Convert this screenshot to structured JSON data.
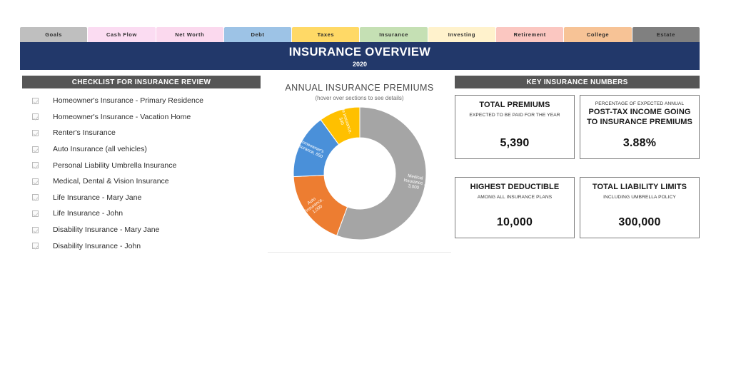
{
  "tabs": [
    {
      "label": "Goals",
      "color": "#bfbfbf",
      "text_color": "#2b2b2b",
      "active": true
    },
    {
      "label": "Cash Flow",
      "color": "#fbdcf2",
      "text_color": "#2b2b2b",
      "active": false
    },
    {
      "label": "Net Worth",
      "color": "#fbd9ee",
      "text_color": "#2b2b2b",
      "active": false
    },
    {
      "label": "Debt",
      "color": "#9dc3e6",
      "text_color": "#2b2b2b",
      "active": false
    },
    {
      "label": "Taxes",
      "color": "#ffd966",
      "text_color": "#2b2b2b",
      "active": false
    },
    {
      "label": "Insurance",
      "color": "#c5e0b4",
      "text_color": "#2b2b2b",
      "active": false
    },
    {
      "label": "Investing",
      "color": "#fff2cc",
      "text_color": "#2b2b2b",
      "active": false
    },
    {
      "label": "Retirement",
      "color": "#fbc7c1",
      "text_color": "#2b2b2b",
      "active": false
    },
    {
      "label": "College",
      "color": "#f7c396",
      "text_color": "#2b2b2b",
      "active": false
    },
    {
      "label": "Estate",
      "color": "#808080",
      "text_color": "#2b2b2b",
      "active": false
    }
  ],
  "banner": {
    "title": "INSURANCE OVERVIEW",
    "year": "2020",
    "background": "#22386a"
  },
  "checklist": {
    "header": "CHECKLIST FOR INSURANCE REVIEW",
    "items": [
      {
        "label": "Homeowner's Insurance - Primary Residence",
        "checked": true
      },
      {
        "label": "Homeowner's Insurance - Vacation Home",
        "checked": true
      },
      {
        "label": "Renter's Insurance",
        "checked": true
      },
      {
        "label": "Auto Insurance (all vehicles)",
        "checked": true
      },
      {
        "label": "Personal Liability Umbrella Insurance",
        "checked": true
      },
      {
        "label": "Medical, Dental & Vision Insurance",
        "checked": true
      },
      {
        "label": "Life Insurance - Mary Jane",
        "checked": true
      },
      {
        "label": "Life Insurance - John",
        "checked": true
      },
      {
        "label": "Disability Insurance - Mary Jane",
        "checked": true
      },
      {
        "label": "Disability Insurance - John",
        "checked": true
      }
    ]
  },
  "chart_data": {
    "type": "pie",
    "title": "ANNUAL INSURANCE PREMIUMS",
    "subtitle": "(hover over sections to see details)",
    "donut": true,
    "legend": "none",
    "categories": [
      "Medical Insurance",
      "Auto Insurance",
      "Homeowner's Insurance",
      "Life Insurance"
    ],
    "values": [
      3000,
      1000,
      850,
      540
    ],
    "total": 5390,
    "colors": [
      "#a5a5a5",
      "#ed7d31",
      "#4a90d9",
      "#ffc000"
    ],
    "data_labels": [
      "Medical Insurance , 3,000",
      "Auto Insurance, 1,000",
      "Homeowner's Insurance, 850",
      "Life Insurance, 540"
    ],
    "label_lines": [
      [
        "Medical",
        "Insurance ,",
        "3,000"
      ],
      [
        "Auto",
        "Insurance,",
        "1,000"
      ],
      [
        "Homeowner's",
        "Insurance, 850"
      ],
      [
        "Life Insurance,",
        "540"
      ]
    ]
  },
  "key_numbers": {
    "header": "KEY INSURANCE NUMBERS",
    "cards": [
      {
        "pretitle": "",
        "title": "TOTAL PREMIUMS",
        "subtitle": "EXPECTED TO BE PAID FOR THE YEAR",
        "value": "5,390"
      },
      {
        "pretitle": "PERCENTAGE OF EXPECTED ANNUAL",
        "title": "POST-TAX INCOME GOING TO INSURANCE PREMIUMS",
        "subtitle": "",
        "value": "3.88%"
      },
      {
        "pretitle": "",
        "title": "HIGHEST DEDUCTIBLE",
        "subtitle": "AMONG ALL INSURANCE PLANS",
        "value": "10,000"
      },
      {
        "pretitle": "",
        "title": "TOTAL LIABILITY LIMITS",
        "subtitle": "INCLUDING UMBRELLA POLICY",
        "value": "300,000"
      }
    ]
  }
}
